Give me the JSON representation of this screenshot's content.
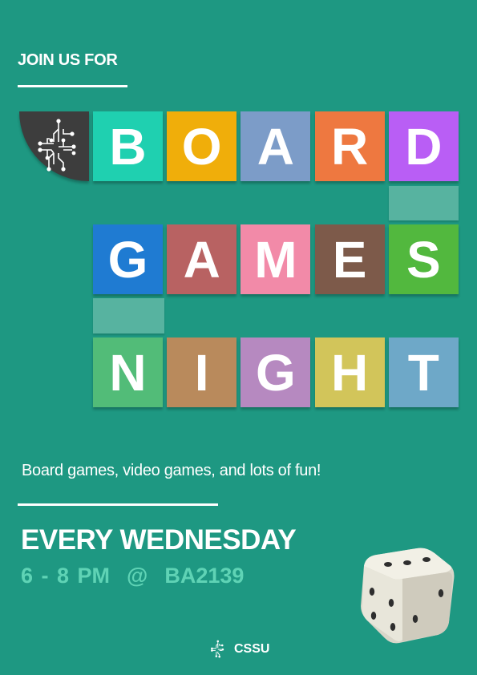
{
  "header": {
    "intro": "JOIN US FOR"
  },
  "title": {
    "rows": [
      [
        {
          "letter": "B",
          "color": "#1fd0b0"
        },
        {
          "letter": "O",
          "color": "#f0ae0a"
        },
        {
          "letter": "A",
          "color": "#7c9cc8"
        },
        {
          "letter": "R",
          "color": "#ee7840"
        },
        {
          "letter": "D",
          "color": "#b95ef5"
        }
      ],
      [
        {
          "letter": "G",
          "color": "#1f7bd2"
        },
        {
          "letter": "A",
          "color": "#b86262"
        },
        {
          "letter": "M",
          "color": "#f28aa8"
        },
        {
          "letter": "E",
          "color": "#7d5a4a"
        },
        {
          "letter": "S",
          "color": "#52b83e"
        }
      ],
      [
        {
          "letter": "N",
          "color": "#52bc78"
        },
        {
          "letter": "I",
          "color": "#b98a5c"
        },
        {
          "letter": "G",
          "color": "#b689c0"
        },
        {
          "letter": "H",
          "color": "#d2c55a"
        },
        {
          "letter": "T",
          "color": "#6ea8c8"
        }
      ]
    ]
  },
  "tagline": "Board games, video games, and lots of fun!",
  "schedule": {
    "day": "EVERY WEDNESDAY",
    "time": "6 - 8 PM  @  BA2139"
  },
  "footer": {
    "org": "CSSU",
    "logo_icon": "circuit-cross-icon"
  },
  "colors": {
    "background": "#1e9882",
    "accent": "#5fd3b5",
    "logo_dark": "#3d3d3d"
  }
}
